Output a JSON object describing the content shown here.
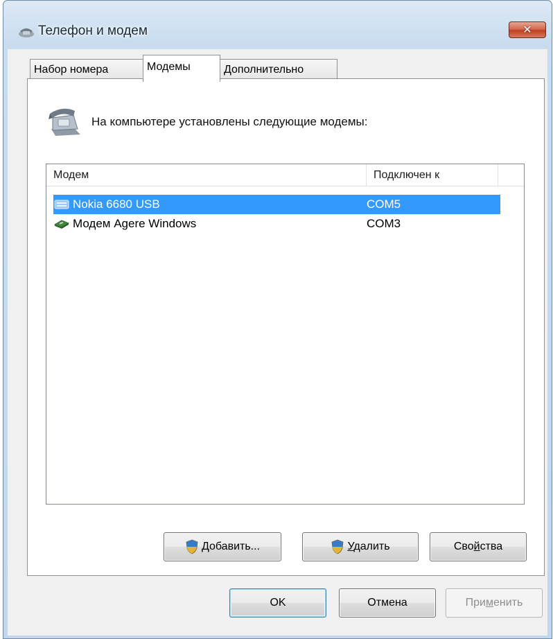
{
  "window": {
    "title": "Телефон и модем",
    "close_glyph": "✕"
  },
  "tabs": [
    {
      "label": "Набор номера",
      "active": false
    },
    {
      "label": "Модемы",
      "active": true
    },
    {
      "label": "Дополнительно",
      "active": false
    }
  ],
  "panel": {
    "intro": "На компьютере установлены следующие модемы:"
  },
  "listview": {
    "columns": [
      "Модем",
      "Подключен к"
    ],
    "rows": [
      {
        "name": "Nokia 6680 USB",
        "port": "COM5",
        "icon": "usb-modem-icon",
        "selected": true
      },
      {
        "name": "Модем Agere Windows",
        "port": "COM3",
        "icon": "modem-card-icon",
        "selected": false
      }
    ]
  },
  "panel_buttons": {
    "add_prefix": "",
    "add_mnemonic": "Д",
    "add_rest": "обавить...",
    "remove_mnemonic": "У",
    "remove_rest": "далить",
    "props_pre": "Сво",
    "props_mnemonic": "й",
    "props_post": "ства"
  },
  "dialog_buttons": {
    "ok": "OK",
    "cancel": "Отмена",
    "apply_pre": "При",
    "apply_mnemonic": "м",
    "apply_post": "енить"
  },
  "colors": {
    "selection": "#3399ff",
    "window_frame": "#c9dcef",
    "close_button": "#c13f24"
  }
}
